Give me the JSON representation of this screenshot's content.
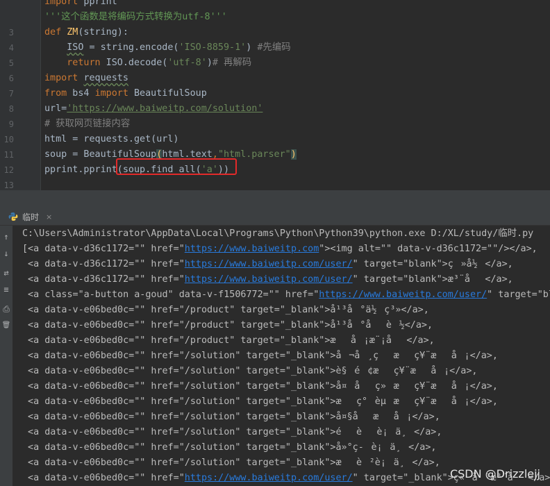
{
  "editor": {
    "lines": [
      {
        "n": "",
        "html": "<span class='tok-kw'>import</span> pprint"
      },
      {
        "n": "",
        "html": "<span class='tok-doc'>'''这个函数是将编码方式转换为utf-8'''</span>"
      },
      {
        "n": "3",
        "html": "<span class='tok-kw'>def</span> <span class='tok-fn'>ZM</span>(string):"
      },
      {
        "n": "4",
        "html": "    <span class='tok-ul'>ISO</span> = string.encode(<span class='tok-str'>'ISO-8859-1'</span>) <span class='tok-cmt'>#先编码</span>"
      },
      {
        "n": "5",
        "html": "    <span class='tok-kw'>return</span> ISO.decode(<span class='tok-str'>'utf-8'</span>)<span class='tok-cmt'># 再解码</span>"
      },
      {
        "n": "6",
        "html": "<span class='tok-kw'>import</span> <span class='tok-ul'>requests</span>"
      },
      {
        "n": "7",
        "html": "<span class='tok-kw'>from</span> bs4 <span class='tok-kw'>import</span> BeautifulSoup"
      },
      {
        "n": "8",
        "html": "url=<span class='tok-url'>'https://www.baiweitp.com/solution'</span>"
      },
      {
        "n": "9",
        "html": "<span class='tok-cmt'># 获取网页链接内容</span>"
      },
      {
        "n": "10",
        "html": "html = requests.get(url)"
      },
      {
        "n": "11",
        "html": "soup = BeautifulSoup<span class='tok-yel'>(</span>html.text<span class='tok-orange'>,</span><span class='tok-str'>\"html.parser\"</span><span class='tok-yel'>)</span>"
      },
      {
        "n": "12",
        "html": "pprint.pprint(soup.find_all(<span class='tok-str'>'a'</span>))"
      },
      {
        "n": "13",
        "html": ""
      }
    ]
  },
  "run": {
    "tab_label": "临时",
    "close_glyph": "×",
    "toolbar_icons": [
      "↑",
      "↓",
      "⇄",
      "≡",
      "⎙",
      "🗑"
    ],
    "output": [
      {
        "t": "C:\\Users\\Administrator\\AppData\\Local\\Programs\\Python\\Python39\\python.exe D:/XL/study/临时.py"
      },
      {
        "a": "[<a data-v-d36c1172=\"\" href=\"",
        "link": "https://www.baiweitp.com",
        "b": "\"><img alt=\"\" data-v-d36c1172=\"\"/></a>,"
      },
      {
        "a": " <a data-v-d36c1172=\"\" href=\"",
        "link": "https://www.baiweitp.com/user/",
        "b": "\" target=\"blank\">ç»å½</a>,"
      },
      {
        "a": " <a data-v-d36c1172=\"\" href=\"",
        "link": "https://www.baiweitp.com/user/",
        "b": "\" target=\"blank\">æ³¨å</a>,"
      },
      {
        "a": " <a class=\"a-button a-goud\" data-v-f1506772=\"\" href=\"",
        "link": "https://www.baiweitp.com/user/",
        "b": "\" target=\"bl"
      },
      {
        "t": " <a data-v-e06bed0c=\"\" href=\"/product\" target=\"_blank\">å¹³å°ä½ç³»</a>,"
      },
      {
        "t": " <a data-v-e06bed0c=\"\" href=\"/product\" target=\"_blank\">å¹³å°åè½</a>,"
      },
      {
        "t": " <a data-v-e06bed0c=\"\" href=\"/product\" target=\"_blank\">æå¡æ¨¡å</a>,"
      },
      {
        "t": " <a data-v-e06bed0c=\"\" href=\"/solution\" target=\"_blank\">å¬å¸çæç¥¨æå¡</a>,"
      },
      {
        "t": " <a data-v-e06bed0c=\"\" href=\"/solution\" target=\"_blank\">è§é¢æç¥¨æå¡</a>,"
      },
      {
        "t": " <a data-v-e06bed0c=\"\" href=\"/solution\" target=\"_blank\">å¤åç»æç¥¨æå¡</a>,"
      },
      {
        "t": " <a data-v-e06bed0c=\"\" href=\"/solution\" target=\"_blank\">æç°èµæç¥¨æå¡</a>,"
      },
      {
        "t": " <a data-v-e06bed0c=\"\" href=\"/solution\" target=\"_blank\">å¤§åæå¡</a>,"
      },
      {
        "t": " <a data-v-e06bed0c=\"\" href=\"/solution\" target=\"_blank\">éèè¡ä¸</a>,"
      },
      {
        "t": " <a data-v-e06bed0c=\"\" href=\"/solution\" target=\"_blank\">å»°ç-è¡ä¸</a>,"
      },
      {
        "t": " <a data-v-e06bed0c=\"\" href=\"/solution\" target=\"_blank\">æè²è¡ä¸</a>,"
      },
      {
        "a": " <a data-v-e06bed0c=\"\" href=\"",
        "link": "https://www.baiweitp.com/user/",
        "b": "\" target=\"_blank\">ç«å³æ³¨å</a>,"
      }
    ]
  },
  "watermark": "CSDN @Drizzlejj"
}
